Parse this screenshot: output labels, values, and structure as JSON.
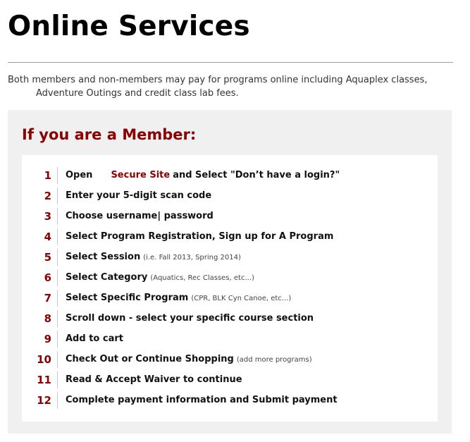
{
  "page": {
    "title": "Online Services",
    "intro_line1": "Both members and non-members may pay for programs online including Aquaplex classes,",
    "intro_line2": "Adventure Outings and credit class lab fees."
  },
  "member_panel": {
    "heading": "If you are a Member:",
    "colors": {
      "accent": "#8b0000",
      "panel_bg": "#f0f0f0",
      "card_bg": "#ffffff"
    },
    "steps": [
      {
        "num": "1",
        "pre": "Open",
        "link": "Secure Site",
        "post": "and Select \"Don’t have a login?\""
      },
      {
        "num": "2",
        "text": "Enter your 5-digit scan code"
      },
      {
        "num": "3",
        "text": "Choose username| password"
      },
      {
        "num": "4",
        "text": "Select Program Registration, Sign up for A Program"
      },
      {
        "num": "5",
        "text": "Select Session",
        "note": "(i.e. Fall 2013, Spring 2014)"
      },
      {
        "num": "6",
        "text": "Select Category",
        "note": "(Aquatics, Rec Classes, etc...)"
      },
      {
        "num": "7",
        "text": "Select Specific Program",
        "note": "(CPR, BLK Cyn Canoe, etc...)"
      },
      {
        "num": "8",
        "text": "Scroll down - select your specific course section"
      },
      {
        "num": "9",
        "text": "Add to cart"
      },
      {
        "num": "10",
        "text": "Check Out or Continue Shopping",
        "note": "(add more programs)"
      },
      {
        "num": "11",
        "text": "Read & Accept Waiver to continue"
      },
      {
        "num": "12",
        "text": "Complete payment information and Submit payment"
      }
    ]
  }
}
